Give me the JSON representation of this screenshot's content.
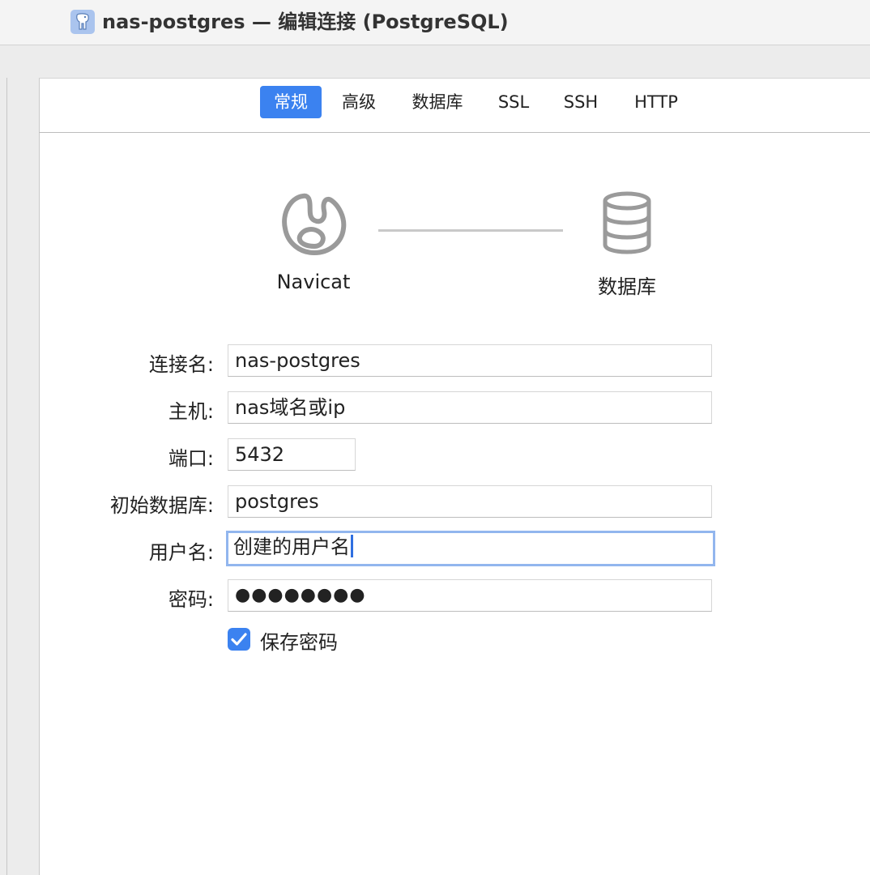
{
  "window": {
    "title": "nas-postgres — 编辑连接 (PostgreSQL)",
    "app_icon": "postgresql-elephant-icon"
  },
  "tabs": [
    {
      "label": "常规",
      "active": true
    },
    {
      "label": "高级",
      "active": false
    },
    {
      "label": "数据库",
      "active": false
    },
    {
      "label": "SSL",
      "active": false
    },
    {
      "label": "SSH",
      "active": false
    },
    {
      "label": "HTTP",
      "active": false
    }
  ],
  "diagram": {
    "left_label": "Navicat",
    "left_icon": "navicat-logo-icon",
    "right_label": "数据库",
    "right_icon": "database-icon"
  },
  "form": {
    "connection_name": {
      "label": "连接名:",
      "value": "nas-postgres"
    },
    "host": {
      "label": "主机:",
      "value": "nas域名或ip"
    },
    "port": {
      "label": "端口:",
      "value": "5432"
    },
    "initial_database": {
      "label": "初始数据库:",
      "value": "postgres"
    },
    "username": {
      "label": "用户名:",
      "value": "创建的用户名"
    },
    "password": {
      "label": "密码:",
      "value": "●●●●●●●●"
    },
    "save_password": {
      "label": "保存密码",
      "checked": true
    }
  },
  "colors": {
    "accent": "#3b82f0",
    "focus_ring": "#92b6ee",
    "icon_gray": "#9a9a9a"
  }
}
